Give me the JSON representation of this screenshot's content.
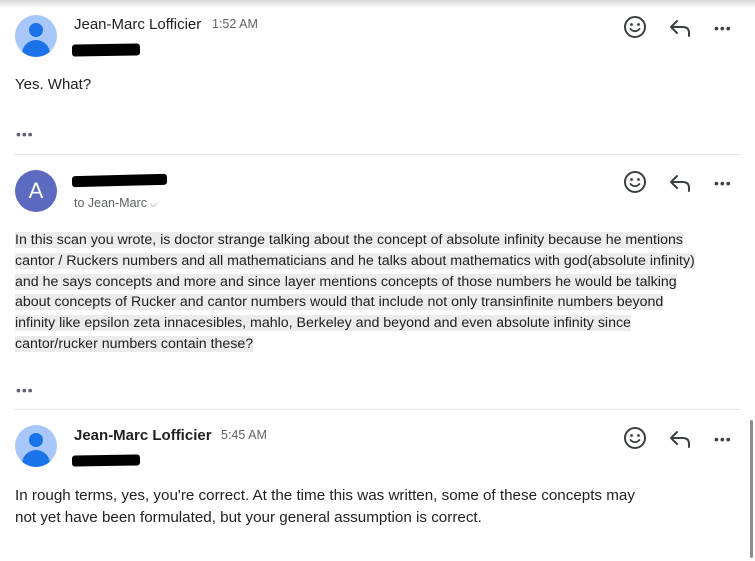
{
  "messages": [
    {
      "sender": "Jean-Marc Lofficier",
      "time": "1:52 AM",
      "avatar_icon": "person-avatar-icon",
      "body": "Yes. What?",
      "trimmed_indicator": "•••"
    },
    {
      "avatar_letter": "A",
      "recipient": "to Jean-Marc",
      "body_lines": [
        "In this scan you wrote, is doctor strange talking about the concept of absolute infinity because he mentions",
        "cantor / Ruckers numbers and all mathematicians and he talks about mathematics with god(absolute infinity)",
        "and he says concepts and more and since layer mentions concepts of those numbers he would be talking",
        "about concepts of Rucker and cantor numbers would that include not only transinfinite numbers beyond",
        "infinity like epsilon zeta innacesibles, mahlo, Berkeley and beyond and even absolute infinity since",
        "cantor/rucker numbers contain these?"
      ],
      "trimmed_indicator": "•••"
    },
    {
      "sender": "Jean-Marc Lofficier",
      "time": "5:45 AM",
      "avatar_icon": "person-avatar-icon",
      "body_lines": [
        "In rough terms, yes, you're correct. At the time this was written, some of these concepts may",
        "not yet have been formulated, but your general assumption is correct."
      ]
    }
  ],
  "actions": {
    "react_icon": "emoji-smile-icon",
    "reply_icon": "reply-arrow-icon",
    "more_icon": "more-horizontal-icon",
    "more_glyph": "•••"
  },
  "colors": {
    "avatar_person_bg": "#a8c7fa",
    "avatar_person_fg": "#1a73e8",
    "avatar_letter_bg": "#5c6bc0",
    "highlight_bg": "#ececec",
    "secondary_text": "#5f6368"
  }
}
